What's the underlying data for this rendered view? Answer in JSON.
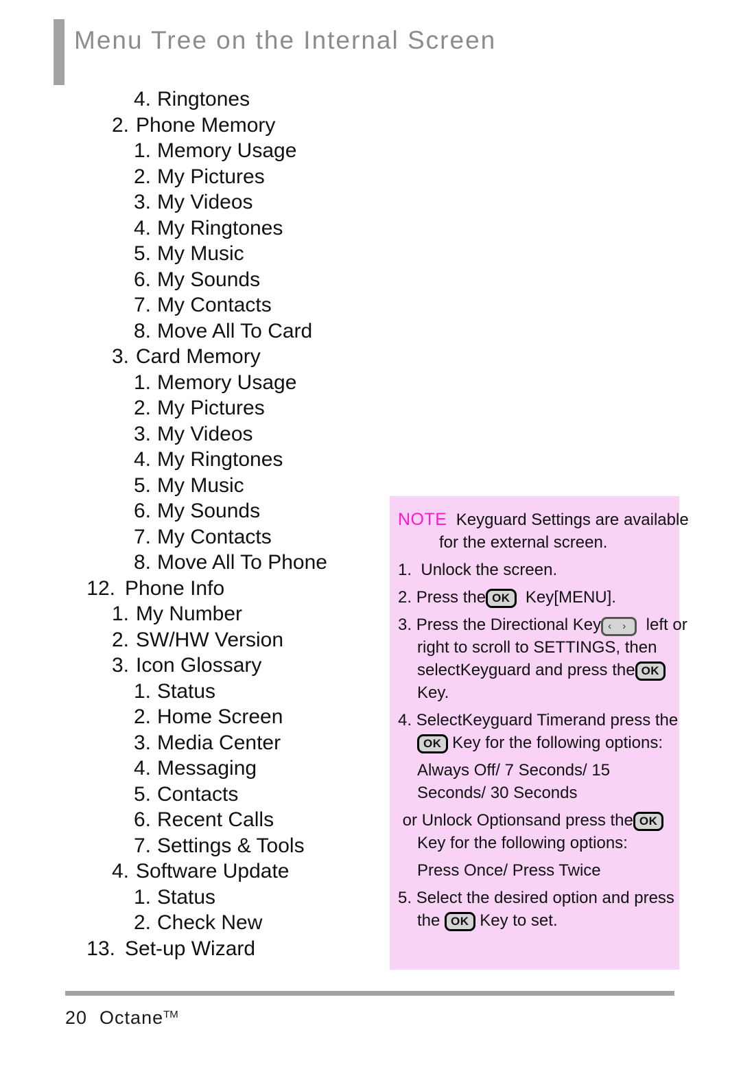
{
  "header": {
    "title": "Menu Tree on the Internal Screen"
  },
  "menu_tree": [
    {
      "level": 3,
      "num": "4.",
      "label": "Ringtones"
    },
    {
      "level": 2,
      "num": "2.",
      "label": "Phone Memory"
    },
    {
      "level": 3,
      "num": "1.",
      "label": "Memory Usage"
    },
    {
      "level": 3,
      "num": "2.",
      "label": "My Pictures"
    },
    {
      "level": 3,
      "num": "3.",
      "label": "My Videos"
    },
    {
      "level": 3,
      "num": "4.",
      "label": "My Ringtones"
    },
    {
      "level": 3,
      "num": "5.",
      "label": "My Music"
    },
    {
      "level": 3,
      "num": "6.",
      "label": "My Sounds"
    },
    {
      "level": 3,
      "num": "7.",
      "label": "My Contacts"
    },
    {
      "level": 3,
      "num": "8.",
      "label": "Move All To Card"
    },
    {
      "level": 2,
      "num": "3.",
      "label": "Card Memory"
    },
    {
      "level": 3,
      "num": "1.",
      "label": "Memory Usage"
    },
    {
      "level": 3,
      "num": "2.",
      "label": "My Pictures"
    },
    {
      "level": 3,
      "num": "3.",
      "label": "My Videos"
    },
    {
      "level": 3,
      "num": "4.",
      "label": "My Ringtones"
    },
    {
      "level": 3,
      "num": "5.",
      "label": "My Music"
    },
    {
      "level": 3,
      "num": "6.",
      "label": "My Sounds"
    },
    {
      "level": 3,
      "num": "7.",
      "label": "My Contacts"
    },
    {
      "level": 3,
      "num": "8.",
      "label": "Move All To Phone"
    },
    {
      "level": 1,
      "num": "12.",
      "label": "Phone Info"
    },
    {
      "level": 2,
      "num": "1.",
      "label": "My Number"
    },
    {
      "level": 2,
      "num": "2.",
      "label": "SW/HW Version"
    },
    {
      "level": 2,
      "num": "3.",
      "label": "Icon Glossary"
    },
    {
      "level": 3,
      "num": "1.",
      "label": "Status"
    },
    {
      "level": 3,
      "num": "2.",
      "label": "Home Screen"
    },
    {
      "level": 3,
      "num": "3.",
      "label": "Media Center"
    },
    {
      "level": 3,
      "num": "4.",
      "label": "Messaging"
    },
    {
      "level": 3,
      "num": "5.",
      "label": "Contacts"
    },
    {
      "level": 3,
      "num": "6.",
      "label": "Recent Calls"
    },
    {
      "level": 3,
      "num": "7.",
      "label": "Settings & Tools"
    },
    {
      "level": 2,
      "num": "4.",
      "label": "Software Update"
    },
    {
      "level": 3,
      "num": "1.",
      "label": "Status"
    },
    {
      "level": 3,
      "num": "2.",
      "label": "Check New"
    },
    {
      "level": 1,
      "num": "13.",
      "label": "Set-up Wizard"
    }
  ],
  "note": {
    "label": "NOTE",
    "intro_line_1": "Keyguard Settings are available",
    "intro_line_2": "for the external screen.",
    "steps": {
      "s1_num": "1.",
      "s1_text": "Unlock the screen.",
      "s2_num": "2.",
      "s2_a": "Press the",
      "s2_key": "OK",
      "s2_b": "Key",
      "s2_c": "[MENU].",
      "s3_num": "3.",
      "s3_a": "Press the Directional Key",
      "s3_key_dir": "‹ ›",
      "s3_b": "left or",
      "s3_c": "right to scroll to SETTINGS",
      "s3_d": ", then",
      "s3_e": "select",
      "s3_f": "Keyguard",
      "s3_g": "and press the",
      "s3_key_ok": "OK",
      "s3_h": "Key.",
      "s4_num": "4.",
      "s4_a": "Select",
      "s4_b": "Keyguard Timer",
      "s4_c": "and press the",
      "s4_key_ok": "OK",
      "s4_d": "Key for the following options:",
      "s4_opt_1": "Always Off/ 7 Seconds/ 15",
      "s4_opt_2": "Seconds/ 30 Seconds",
      "alt_a": "or",
      "alt_b": "Unlock Options",
      "alt_c": "and press the",
      "alt_key_ok": "OK",
      "alt_d": "Key for the following options:",
      "alt_opt_1": "Press Once/ Press Twice",
      "s5_num": "5.",
      "s5_a": "Select the desired option and press",
      "s5_b": "the",
      "s5_key_ok": "OK",
      "s5_c": "Key to set."
    }
  },
  "footer": {
    "page_number": "20",
    "product": "Octane",
    "trademark": "TM"
  },
  "colors": {
    "note_background": "#f8d3f6",
    "note_label": "#ff18d2",
    "title": "#8c8c8c",
    "rule": "#a3a3a3"
  }
}
